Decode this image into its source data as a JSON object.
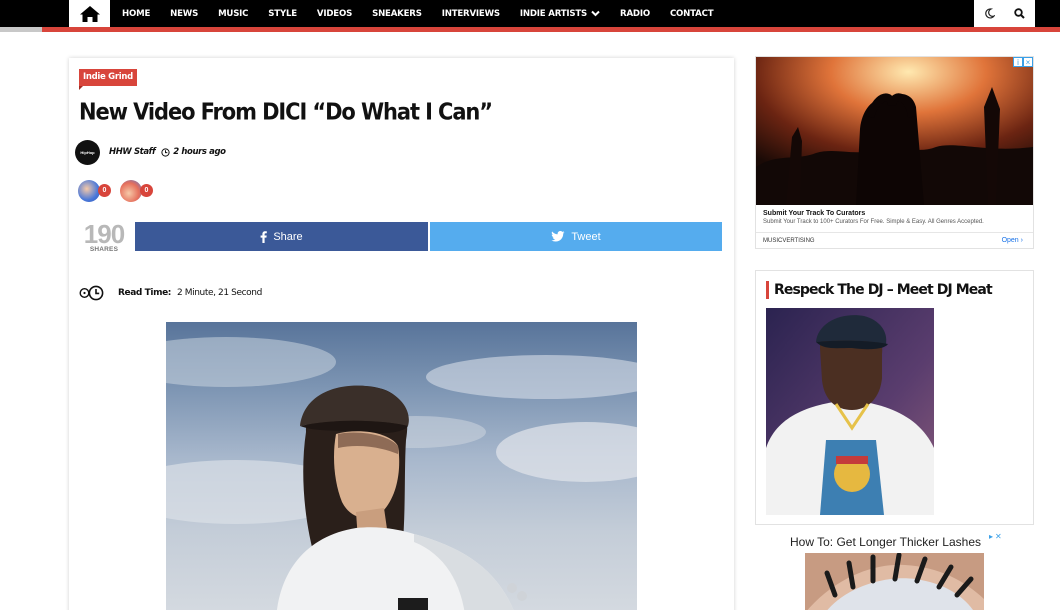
{
  "nav": {
    "home_icon": "home-icon",
    "items": [
      {
        "label": "HOME"
      },
      {
        "label": "NEWS"
      },
      {
        "label": "MUSIC"
      },
      {
        "label": "STYLE"
      },
      {
        "label": "VIDEOS"
      },
      {
        "label": "SNEAKERS"
      },
      {
        "label": "INTERVIEWS"
      },
      {
        "label": "INDIE ARTISTS"
      },
      {
        "label": "RADIO"
      },
      {
        "label": "CONTACT"
      }
    ],
    "tools": [
      "moon-icon",
      "search-icon"
    ],
    "accent_color": "#d8453b"
  },
  "article": {
    "category": "Indie Grind",
    "title": "New Video From DICI “Do What I Can”",
    "author_avatar_text": "HipHop",
    "author": "HHW Staff",
    "time_ago": "2 hours ago",
    "reactions": [
      {
        "icon": "like-reaction-icon",
        "count": "0"
      },
      {
        "icon": "dislike-reaction-icon",
        "count": "0"
      }
    ],
    "shares": {
      "count": "190",
      "label": "SHARES"
    },
    "share_buttons": {
      "facebook": "Share",
      "twitter": "Tweet",
      "facebook_color": "#3b5998",
      "twitter_color": "#55acee"
    },
    "read_time": {
      "label": "Read Time:",
      "value": "2 Minute, 21 Second"
    }
  },
  "sidebar": {
    "ad1": {
      "title": "Submit Your Track To Curators",
      "description": "Submit Your Track to 100+ Curators For Free. Simple & Easy. All Genres Accepted.",
      "brand": "MUSICVERTISING",
      "cta": "Open"
    },
    "widget": {
      "title": "Respeck The DJ – Meet DJ Meat"
    },
    "ad2": {
      "text": "How To: Get Longer Thicker Lashes"
    }
  }
}
